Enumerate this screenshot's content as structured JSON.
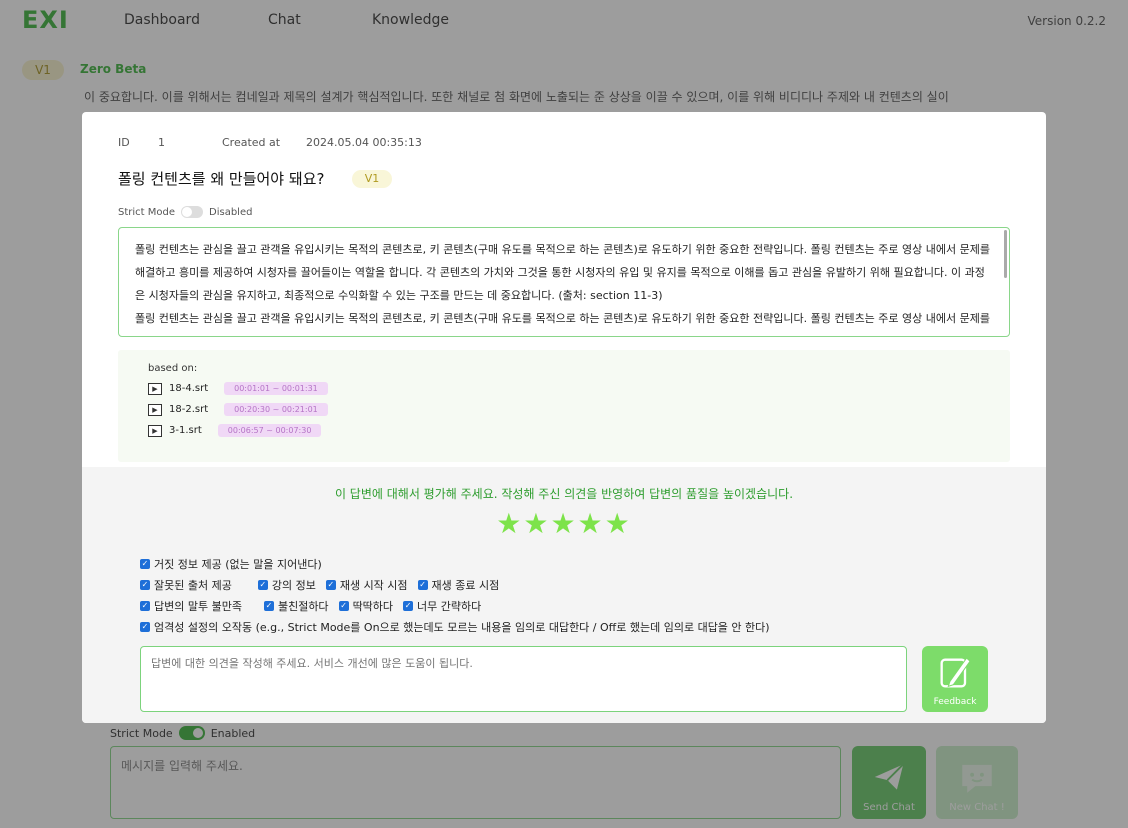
{
  "nav": {
    "logo": "EXI",
    "items": [
      "Dashboard",
      "Chat",
      "Knowledge"
    ],
    "version": "Version 0.2.2"
  },
  "chat_header": {
    "badge": "V1",
    "name": "Zero Beta",
    "background_text": "이 중요합니다. 이를 위해서는 컴네일과 제목의 설계가 핵심적입니다. 또한 채널로 첨 화면에 노출되는 준 상상을 이끌 수 있으며, 이를 위해 비디디나 주제와 내 컨텐츠의 실이"
  },
  "modal": {
    "id_label": "ID",
    "id_value": "1",
    "created_label": "Created at",
    "created_value": "2024.05.04 00:35:13",
    "title": "폴링 컨텐츠를 왜 만들어야 돼요?",
    "version_badge": "V1",
    "strict_label": "Strict Mode",
    "strict_state": "Disabled",
    "answer_p1": "폴링 컨텐츠는 관심을 끌고 관객을 유입시키는 목적의 콘텐츠로, 키 콘텐츠(구매 유도를 목적으로 하는 콘텐츠)로 유도하기 위한 중요한 전략입니다. 폴링 컨텐츠는 주로 영상 내에서 문제를 해결하고 흥미를 제공하여 시청자를 끌어들이는 역할을 합니다. 각 콘텐츠의 가치와 그것을 통한 시청자의 유입 및 유지를 목적으로 이해를 돕고 관심을 유발하기 위해 필요합니다. 이 과정은 시청자들의 관심을 유지하고, 최종적으로 수익화할 수 있는 구조를 만드는 데 중요합니다. (출처: section 11-3)",
    "answer_p2": "폴링 컨텐츠는 관심을 끌고 관객을 유입시키는 목적의 콘텐츠로, 키 콘텐츠(구매 유도를 목적으로 하는 콘텐츠)로 유도하기 위한 중요한 전략입니다. 폴링 컨텐츠는 주로 영상 내에서 문제를 해",
    "based_on_label": "based on:",
    "sources": [
      {
        "file": "18-4.srt",
        "range": "00:01:01 ~ 00:01:31"
      },
      {
        "file": "18-2.srt",
        "range": "00:20:30 ~ 00:21:01"
      },
      {
        "file": "3-1.srt",
        "range": "00:06:57 ~ 00:07:30"
      }
    ]
  },
  "feedback": {
    "prompt": "이 답변에 대해서 평가해 주세요. 작성해 주신 의견을 반영하여 답변의 품질을 높이겠습니다.",
    "stars": "★★★★★",
    "rating": 5,
    "checkboxes": {
      "row1": [
        "거짓 정보 제공 (없는 말을 지어낸다)"
      ],
      "row2": [
        "잘못된 출처 제공",
        "강의 정보",
        "재생 시작 시점",
        "재생 종료 시점"
      ],
      "row3": [
        "답변의 말투 불만족",
        "불친절하다",
        "딱딱하다",
        "너무 간략하다"
      ],
      "row4": [
        "엄격성 설정의 오작동 (e.g., Strict Mode를 On으로 했는데도 모르는 내용을 임의로 대답한다 / Off로 했는데 임의로 대답을 안 한다)"
      ]
    },
    "input_placeholder": "답변에 대한 의견을 작성해 주세요. 서비스 개선에 많은 도움이 됩니다.",
    "button_label": "Feedback"
  },
  "chat_input": {
    "strict_label": "Strict Mode",
    "strict_state": "Enabled",
    "placeholder": "메시지를 입력해 주세요.",
    "send_label": "Send Chat",
    "new_chat_label": "New Chat !"
  },
  "colors": {
    "brand_green": "#2eaf2e",
    "star_green": "#7de34a",
    "checkbox_blue": "#1e6fd8",
    "time_badge": "#f0d8f6"
  }
}
